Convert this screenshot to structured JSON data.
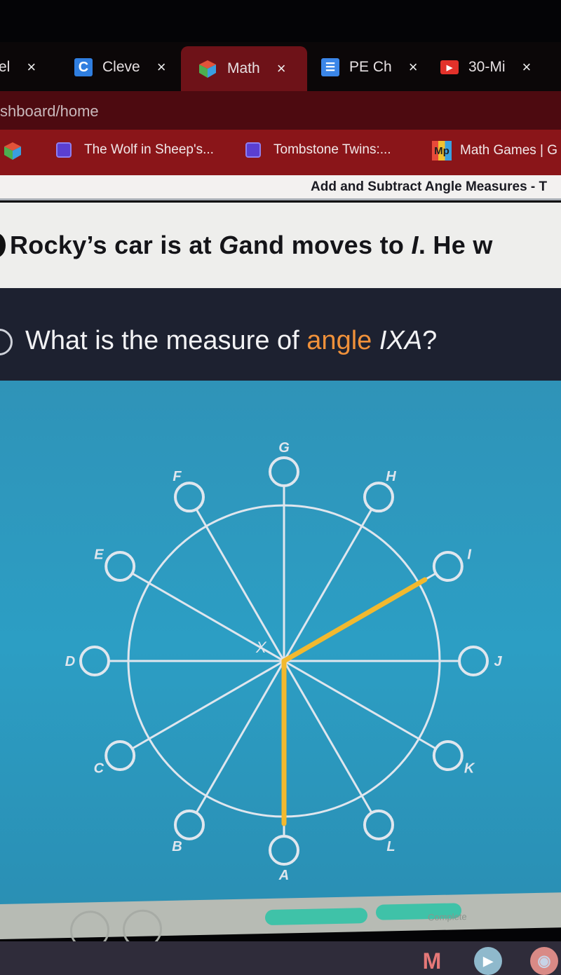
{
  "browser": {
    "tabs": [
      {
        "label": "el",
        "icon": "unknown-tab-icon",
        "active": false
      },
      {
        "label": "Cleve",
        "icon": "clever-icon",
        "active": false
      },
      {
        "label": "Math",
        "icon": "cube-icon",
        "active": true
      },
      {
        "label": "PE Ch",
        "icon": "docs-icon",
        "active": false
      },
      {
        "label": "30-Mi",
        "icon": "youtube-icon",
        "active": false
      }
    ],
    "close_glyph": "×",
    "url": "shboard/home",
    "bookmarks": [
      {
        "label": "",
        "icon": "cube-icon"
      },
      {
        "label": "The Wolf in Sheep's...",
        "icon": "book-icon"
      },
      {
        "label": "Tombstone Twins:...",
        "icon": "book-icon"
      },
      {
        "label": "Math Games | G",
        "icon": "mathplayground-icon"
      }
    ]
  },
  "page": {
    "title": "Add and Subtract Angle Measures - T",
    "story_text": {
      "part1": "Rocky’s car is at ",
      "var1": "G",
      "part2": "and moves to ",
      "var2": "I",
      "part3": ". He w"
    },
    "question": {
      "prefix": "What is the measure of ",
      "highlight": "angle",
      "space": " ",
      "angle_name": "IXA",
      "suffix": "?"
    }
  },
  "diagram": {
    "center_label": "X",
    "spoke_count": 12,
    "spokes": [
      {
        "label": "A",
        "angle_deg": 270
      },
      {
        "label": "B",
        "angle_deg": 240
      },
      {
        "label": "C",
        "angle_deg": 210
      },
      {
        "label": "D",
        "angle_deg": 180
      },
      {
        "label": "E",
        "angle_deg": 150
      },
      {
        "label": "F",
        "angle_deg": 120
      },
      {
        "label": "G",
        "angle_deg": 90
      },
      {
        "label": "H",
        "angle_deg": 60
      },
      {
        "label": "I",
        "angle_deg": 30
      },
      {
        "label": "J",
        "angle_deg": 0
      },
      {
        "label": "K",
        "angle_deg": 330
      },
      {
        "label": "L",
        "angle_deg": 300
      }
    ],
    "highlighted_rays": [
      "I",
      "A"
    ],
    "highlight_color": "#f2b92e",
    "line_color": "#dfe6ee"
  },
  "footer": {
    "progress_segments": 2,
    "status_text": "Complete",
    "progress_color": "#3fc2a8"
  },
  "shelf": {
    "apps": [
      {
        "name": "gmail-icon",
        "glyph": "M"
      },
      {
        "name": "meet-icon",
        "glyph": "▶"
      },
      {
        "name": "chrome-icon",
        "glyph": "◉"
      }
    ]
  }
}
